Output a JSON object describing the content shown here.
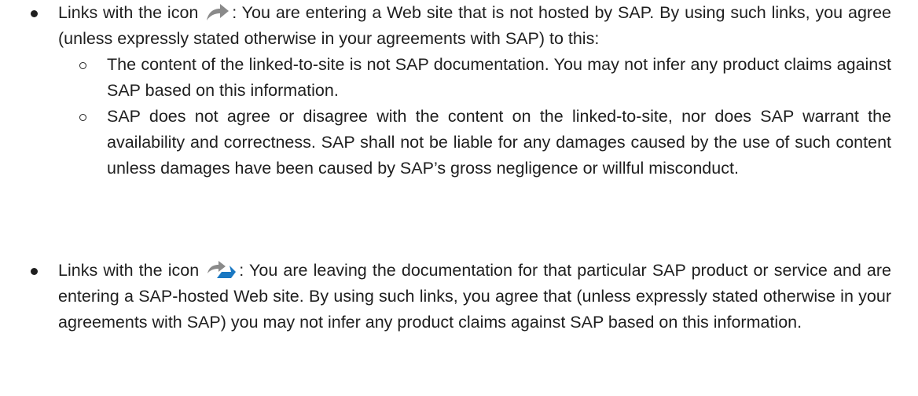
{
  "items": [
    {
      "text_before_icon": "Links with the icon ",
      "icon": "external-link-arrow-icon",
      "text_after_icon": ": You are entering a Web site that is not hosted by SAP. By using such links, you agree (unless expressly stated otherwise in your agreements with SAP) to this:",
      "subitems": [
        "The content of the linked-to-site is not SAP documentation. You may not infer any product claims against SAP based on this information.",
        "SAP does not agree or disagree with the content on the linked-to-site, nor does SAP warrant the availability and correctness. SAP shall not be liable for any damages caused by the use of such content unless damages have been caused by SAP’s gross negligence or willful misconduct."
      ]
    },
    {
      "text_before_icon": "Links with the icon ",
      "icon": "sap-hosted-link-icon",
      "text_after_icon": ": You are leaving the documentation for that particular SAP product or service and are entering a SAP-hosted Web site. By using such links, you agree that (unless expressly stated otherwise in your agreements with SAP) you may not infer any product claims against SAP based on this information."
    }
  ],
  "colors": {
    "text": "#1f1f1f",
    "icon_gray": "#8a8a8a",
    "icon_blue": "#1a78c2"
  }
}
